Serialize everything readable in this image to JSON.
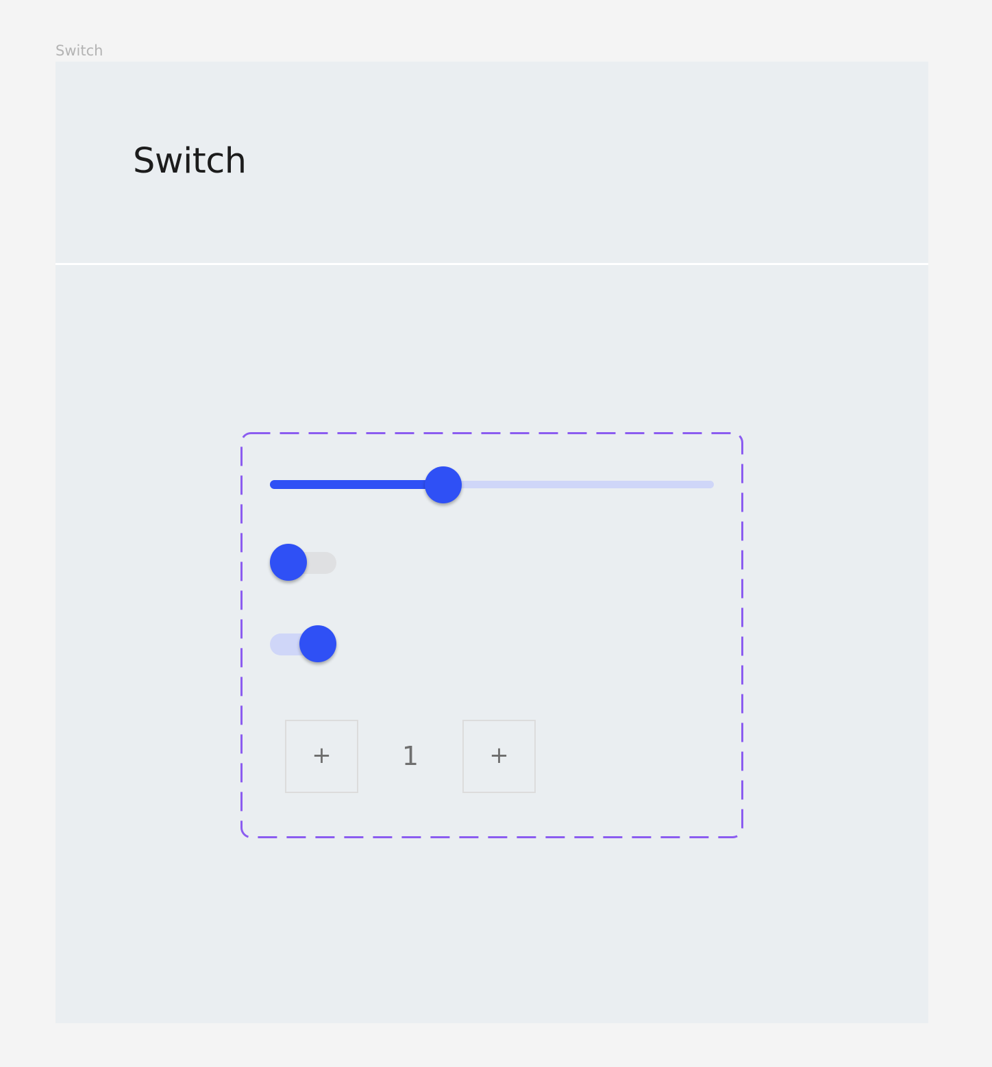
{
  "frame": {
    "label": "Switch"
  },
  "header": {
    "title": "Switch"
  },
  "colors": {
    "accent": "#2f50f5",
    "accent_light": "#cfd6f8",
    "rail_off": "#dfe0e2",
    "dashed_border": "#8b5cf0",
    "frame_bg": "#eaeef1",
    "page_bg": "#f4f4f4"
  },
  "controls": {
    "slider": {
      "value_percent": 39
    },
    "toggles": [
      {
        "state": "off"
      },
      {
        "state": "on"
      }
    ],
    "stepper": {
      "decrement_label": "+",
      "value": "1",
      "increment_label": "+"
    }
  }
}
